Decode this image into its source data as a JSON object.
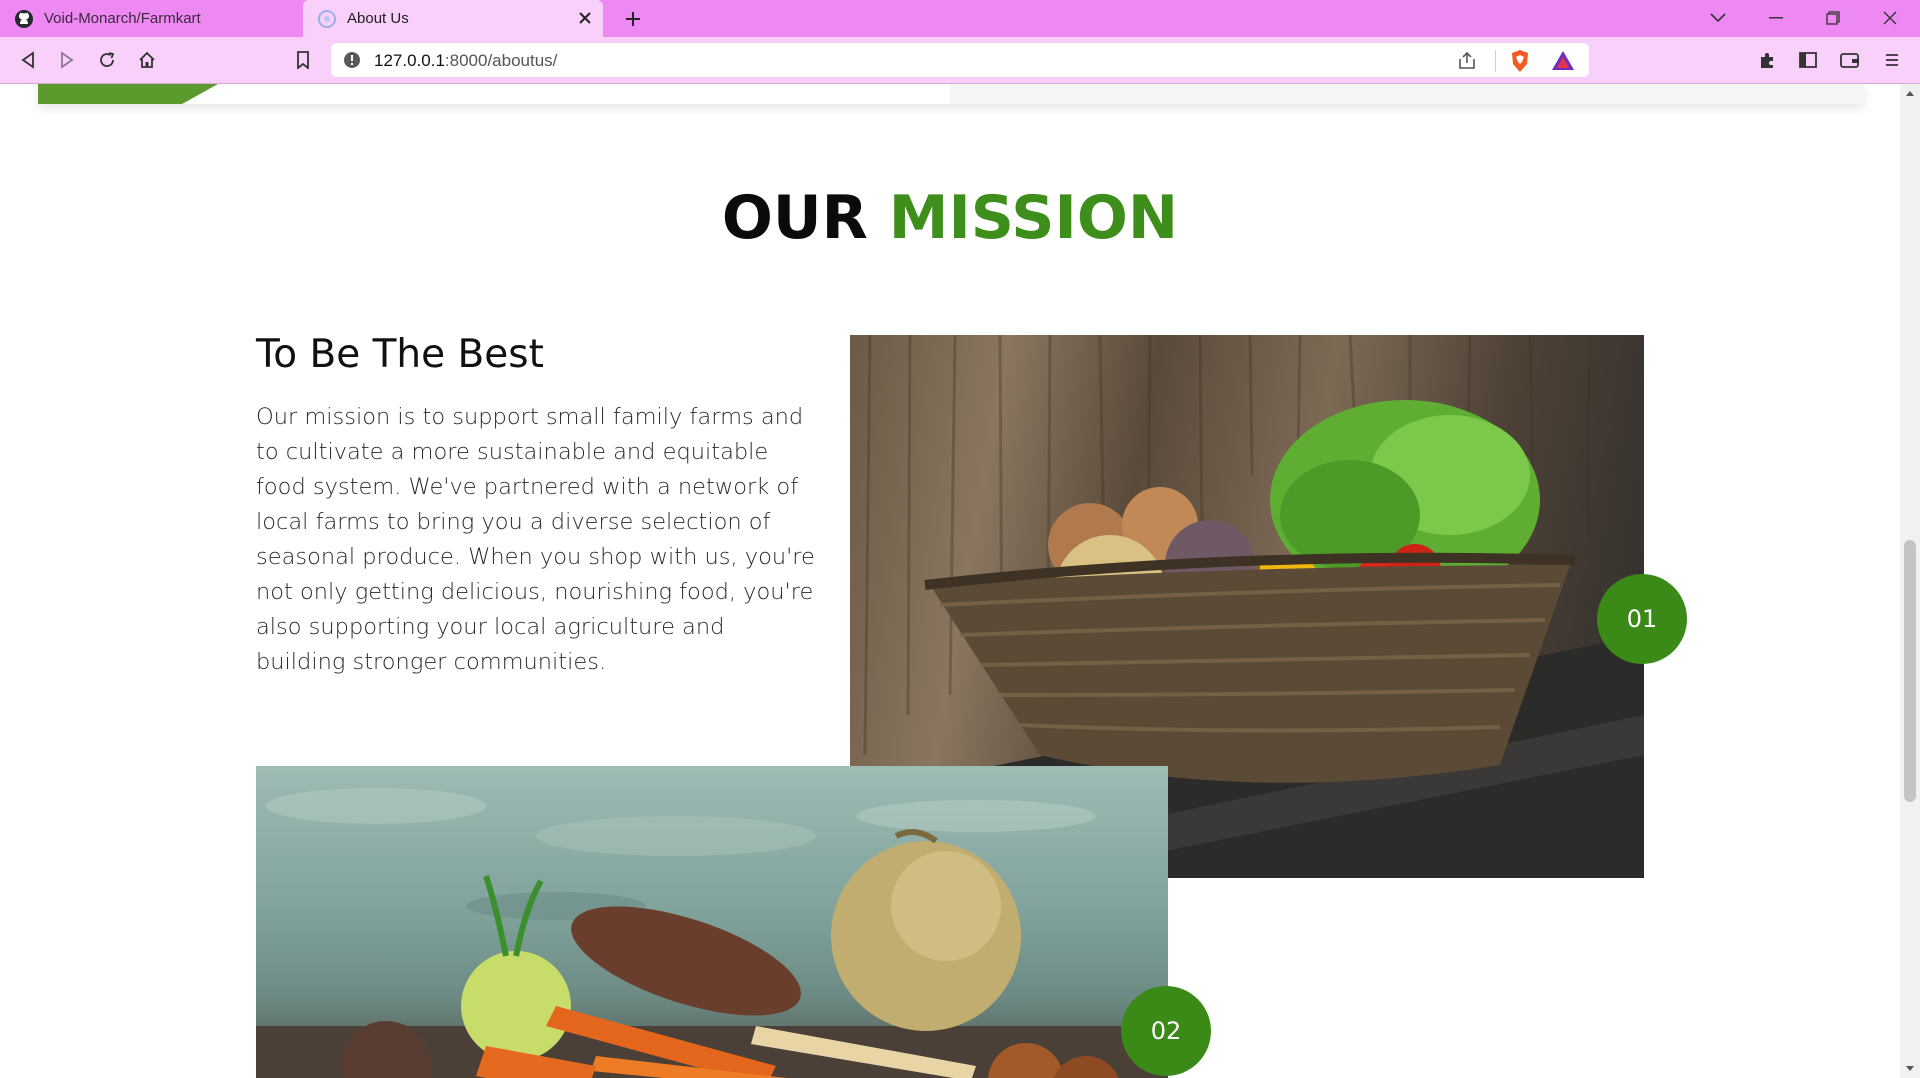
{
  "browser": {
    "tabs": [
      {
        "title": "Void-Monarch/Farmkart",
        "icon": "github-icon",
        "active": false
      },
      {
        "title": "About Us",
        "icon": "site-favicon",
        "active": true
      }
    ],
    "url": {
      "host": "127.0.0.1",
      "rest": ":8000/aboutus/"
    },
    "colors": {
      "tabbar": "#ee88f2",
      "toolbar": "#f8d0f9"
    }
  },
  "page": {
    "mission": {
      "title_part1": "OUR",
      "title_part2": "MISSION",
      "subtitle": "To Be The Best",
      "text": "Our mission is to support small family farms and to cultivate a more sustainable and equitable food system. We've partnered with a network of local farms to bring you a diverse selection of seasonal produce. When you shop with us, you're not only getting delicious, nourishing food, you're also supporting your local agriculture and building stronger communities.",
      "badges": [
        "01",
        "02"
      ],
      "images": [
        "vegetable-basket-photo",
        "root-vegetables-photo"
      ]
    },
    "colors": {
      "accent_green": "#3e8e1c",
      "badge_green": "#3b8a18"
    }
  }
}
